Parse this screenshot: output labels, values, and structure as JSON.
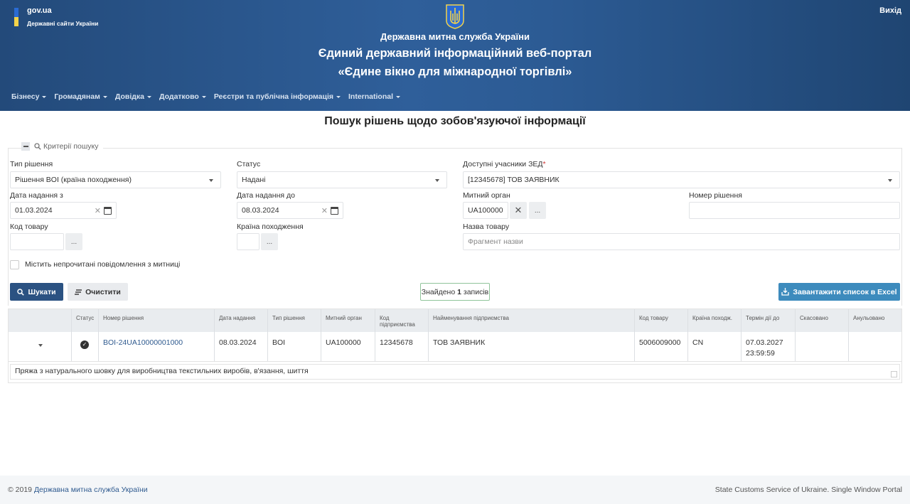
{
  "header": {
    "gov_name": "gov.ua",
    "gov_sub": "Державні сайти України",
    "logout": "Вихід",
    "title1": "Державна митна служба України",
    "title2": "Єдиний державний інформаційний веб-портал",
    "title3": "«Єдине вікно для міжнародної торгівлі»",
    "colors": {
      "flag_blue": "#2a6bd4",
      "flag_yellow": "#f3d34a",
      "header_bg": "#2c5b94"
    }
  },
  "nav": [
    {
      "label": "Бізнесу"
    },
    {
      "label": "Громадянам"
    },
    {
      "label": "Довідка"
    },
    {
      "label": "Додатково"
    },
    {
      "label": "Реєстри та публічна інформація"
    },
    {
      "label": "International"
    }
  ],
  "page_title": "Пошук рішень щодо зобов'язуючої інформації",
  "criteria": {
    "legend": "Критерії пошуку",
    "decision_type": {
      "label": "Тип рішення",
      "value": "Рішення BOI (країна походження)"
    },
    "status": {
      "label": "Статус",
      "value": "Надані"
    },
    "participants": {
      "label": "Доступні учасники ЗЕД",
      "required_mark": "*",
      "value": "[12345678] ТОВ ЗАЯВНИК"
    },
    "date_from": {
      "label": "Дата надання з",
      "value": "01.03.2024"
    },
    "date_to": {
      "label": "Дата надання до",
      "value": "08.03.2024"
    },
    "customs": {
      "label": "Митний орган",
      "value": "UA100000",
      "clear": "✕",
      "more": "..."
    },
    "decision_number": {
      "label": "Номер рішення",
      "value": ""
    },
    "goods_code": {
      "label": "Код товару",
      "value": "",
      "more": "..."
    },
    "origin_country": {
      "label": "Країна походження",
      "value": "",
      "more": "..."
    },
    "goods_name": {
      "label": "Назва товару",
      "placeholder": "Фрагмент назви"
    },
    "unread_checkbox": {
      "label": "Містить непрочитані повідомлення з митниці",
      "checked": false
    }
  },
  "actions": {
    "search": "Шукати",
    "clear": "Очистити",
    "found_prefix": "Знайдено",
    "found_count": "1",
    "found_suffix": "записів",
    "excel": "Завантажити список в Excel"
  },
  "table": {
    "columns": [
      "",
      "Статус",
      "Номер рішення",
      "Дата надання",
      "Тип рішення",
      "Митний орган",
      "Код підприємства",
      "Найменування підприємства",
      "Код товару",
      "Країна походж.",
      "Термін дії до",
      "Скасовано",
      "Анульовано"
    ],
    "rows": [
      {
        "status": "issued",
        "number": "BOI-24UA10000001000",
        "date": "08.03.2024",
        "type": "BOI",
        "customs": "UA100000",
        "company_code": "12345678",
        "company_name": "ТОВ ЗАЯВНИК",
        "goods_code": "5006009000",
        "country": "CN",
        "valid_date": "07.03.2027",
        "valid_time": "23:59:59",
        "cancelled": "",
        "annulled": "",
        "description": "Пряжа з натурального шовку для виробництва текстильних виробів, в'язання, шиття"
      }
    ]
  },
  "footer": {
    "copyright": "© 2019",
    "org_link": "Державна митна служба України",
    "right": "State Customs Service of Ukraine. Single Window Portal"
  }
}
